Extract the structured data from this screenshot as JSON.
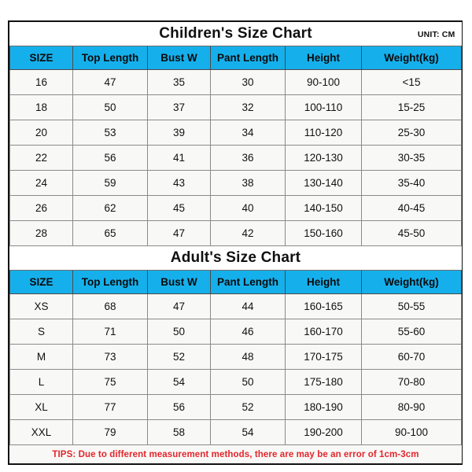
{
  "children": {
    "title": "Children's Size Chart",
    "unit": "UNIT: CM",
    "columns": [
      "SIZE",
      "Top Length",
      "Bust W",
      "Pant Length",
      "Height",
      "Weight(kg)"
    ],
    "rows": [
      [
        "16",
        "47",
        "35",
        "30",
        "90-100",
        "<15"
      ],
      [
        "18",
        "50",
        "37",
        "32",
        "100-110",
        "15-25"
      ],
      [
        "20",
        "53",
        "39",
        "34",
        "110-120",
        "25-30"
      ],
      [
        "22",
        "56",
        "41",
        "36",
        "120-130",
        "30-35"
      ],
      [
        "24",
        "59",
        "43",
        "38",
        "130-140",
        "35-40"
      ],
      [
        "26",
        "62",
        "45",
        "40",
        "140-150",
        "40-45"
      ],
      [
        "28",
        "65",
        "47",
        "42",
        "150-160",
        "45-50"
      ]
    ]
  },
  "adults": {
    "title": "Adult's Size Chart",
    "columns": [
      "SIZE",
      "Top Length",
      "Bust W",
      "Pant Length",
      "Height",
      "Weight(kg)"
    ],
    "rows": [
      [
        "XS",
        "68",
        "47",
        "44",
        "160-165",
        "50-55"
      ],
      [
        "S",
        "71",
        "50",
        "46",
        "160-170",
        "55-60"
      ],
      [
        "M",
        "73",
        "52",
        "48",
        "170-175",
        "60-70"
      ],
      [
        "L",
        "75",
        "54",
        "50",
        "175-180",
        "70-80"
      ],
      [
        "XL",
        "77",
        "56",
        "52",
        "180-190",
        "80-90"
      ],
      [
        "XXL",
        "79",
        "58",
        "54",
        "190-200",
        "90-100"
      ]
    ]
  },
  "tips": "TIPS: Due to different measurement methods, there are may be an error of 1cm-3cm",
  "colors": {
    "header_blue": "#15b0ec",
    "tips_red": "#e2262c",
    "cell_bg": "#f8f8f6",
    "border": "#8a8a8a",
    "outer_border": "#111111"
  }
}
